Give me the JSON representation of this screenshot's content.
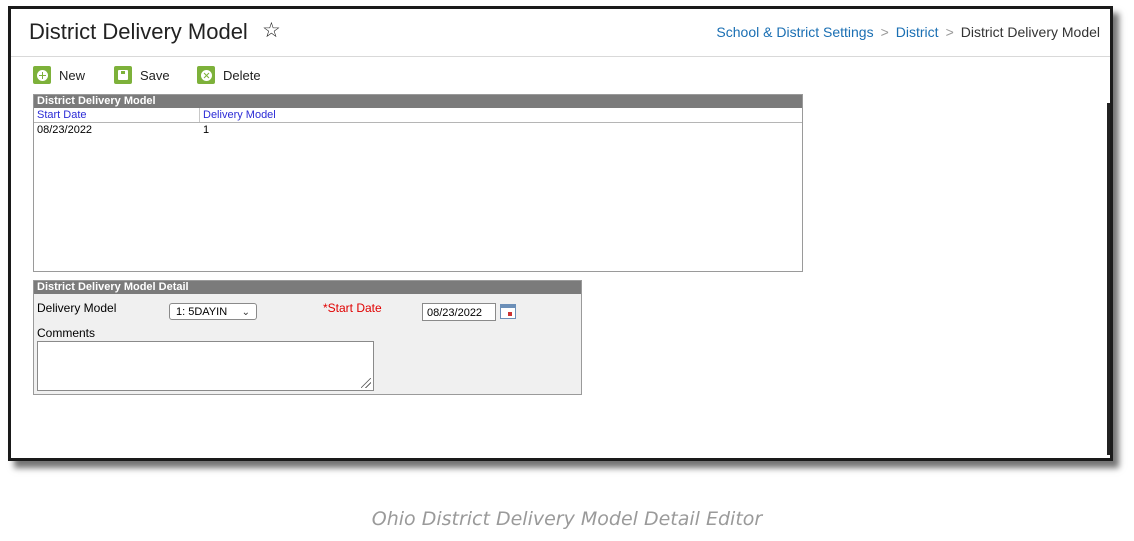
{
  "page": {
    "title": "District Delivery Model",
    "star_icon": "★-outline"
  },
  "breadcrumb": {
    "items": [
      "School & District Settings",
      "District",
      "District Delivery Model"
    ]
  },
  "toolbar": {
    "new_label": "New",
    "save_label": "Save",
    "delete_label": "Delete",
    "accent": "#7db13a"
  },
  "grid": {
    "header": "District Delivery Model",
    "columns": [
      "Start Date",
      "Delivery Model"
    ],
    "rows": [
      {
        "start_date": "08/23/2022",
        "delivery_model": "1"
      }
    ]
  },
  "detail": {
    "header": "District Delivery Model Detail",
    "delivery_model_label": "Delivery Model",
    "delivery_model_value": "1: 5DAYIN",
    "start_date_label": "*Start Date",
    "start_date_value": "08/23/2022",
    "comments_label": "Comments",
    "comments_value": ""
  },
  "caption": "Ohio District Delivery Model Detail Editor"
}
